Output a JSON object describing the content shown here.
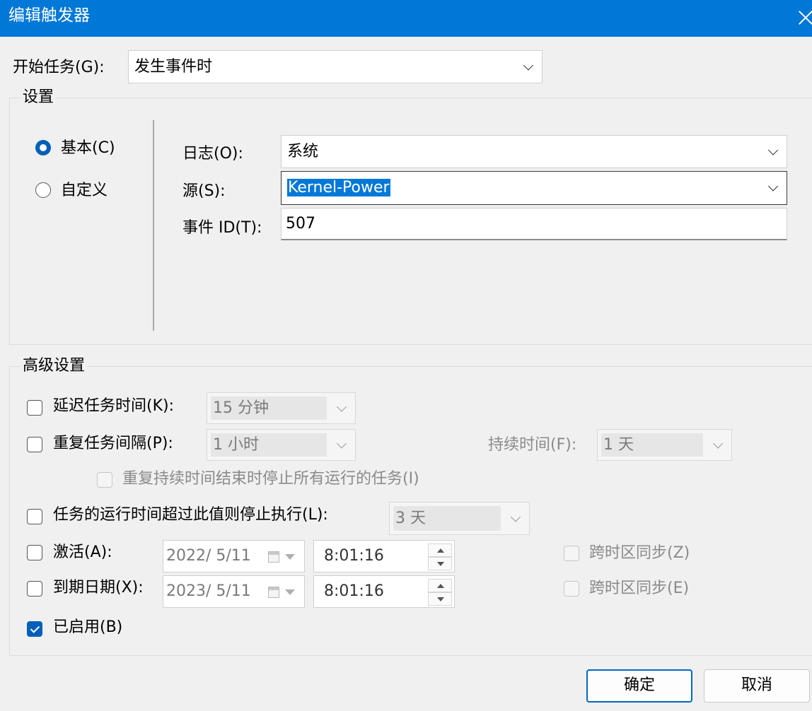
{
  "window": {
    "title": "编辑触发器"
  },
  "begin_task": {
    "label": "开始任务(G):",
    "value": "发生事件时"
  },
  "settings": {
    "legend": "设置",
    "basic_label": "基本(C)",
    "custom_label": "自定义",
    "log": {
      "label": "日志(O):",
      "value": "系统"
    },
    "source": {
      "label": "源(S):",
      "value": "Kernel-Power"
    },
    "event_id": {
      "label": "事件 ID(T):",
      "value": "507"
    }
  },
  "advanced": {
    "legend": "高级设置",
    "delay": {
      "label": "延迟任务时间(K):",
      "value": "15 分钟"
    },
    "repeat": {
      "label": "重复任务间隔(P):",
      "value": "1 小时",
      "duration_label": "持续时间(F):",
      "duration_value": "1 天"
    },
    "stop_all": {
      "label": "重复持续时间结束时停止所有运行的任务(I)"
    },
    "stop_if": {
      "label": "任务的运行时间超过此值则停止执行(L):",
      "value": "3 天"
    },
    "activate": {
      "label": "激活(A):",
      "date": "2022/  5/11",
      "time": "8:01:16",
      "sync_label": "跨时区同步(Z)"
    },
    "expire": {
      "label": "到期日期(X):",
      "date": "2023/  5/11",
      "time": "8:01:16",
      "sync_label": "跨时区同步(E)"
    },
    "enabled": {
      "label": "已启用(B)",
      "checked": true
    }
  },
  "buttons": {
    "ok": "确定",
    "cancel": "取消"
  },
  "colors": {
    "titlebar": "#0078d7",
    "accent": "#005fb8"
  }
}
